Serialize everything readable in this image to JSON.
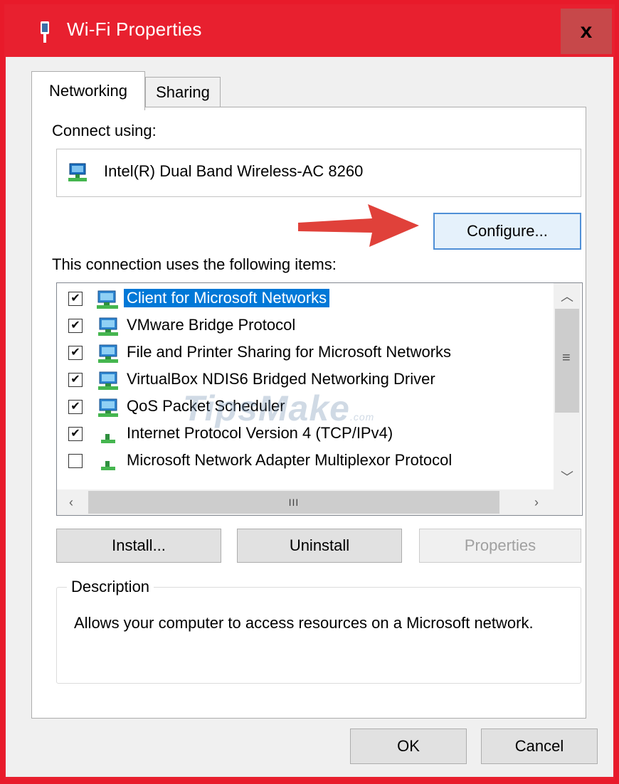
{
  "window": {
    "title": "Wi-Fi Properties",
    "close_glyph": "x",
    "frame_color": "#e81a2a"
  },
  "tabs": [
    {
      "label": "Networking",
      "selected": true
    },
    {
      "label": "Sharing",
      "selected": false
    }
  ],
  "connect_using": {
    "label": "Connect using:",
    "adapter": "Intel(R) Dual Band Wireless-AC 8260",
    "adapter_icon": "network-adapter-icon",
    "configure_label": "Configure..."
  },
  "items_section": {
    "label": "This connection uses the following items:",
    "items": [
      {
        "label": "Client for Microsoft Networks",
        "checked": true,
        "selected": true,
        "icon": "network-client-icon"
      },
      {
        "label": "VMware Bridge Protocol",
        "checked": true,
        "selected": false,
        "icon": "network-service-icon"
      },
      {
        "label": "File and Printer Sharing for Microsoft Networks",
        "checked": true,
        "selected": false,
        "icon": "network-service-icon"
      },
      {
        "label": "VirtualBox NDIS6 Bridged Networking Driver",
        "checked": true,
        "selected": false,
        "icon": "network-service-icon"
      },
      {
        "label": "QoS Packet Scheduler",
        "checked": true,
        "selected": false,
        "icon": "network-service-icon"
      },
      {
        "label": "Internet Protocol Version 4 (TCP/IPv4)",
        "checked": true,
        "selected": false,
        "icon": "network-protocol-icon"
      },
      {
        "label": "Microsoft Network Adapter Multiplexor Protocol",
        "checked": false,
        "selected": false,
        "icon": "network-protocol-icon"
      }
    ]
  },
  "watermark": {
    "text": "TipsMake",
    "suffix": ".com"
  },
  "item_buttons": {
    "install": "Install...",
    "uninstall": "Uninstall",
    "properties": "Properties"
  },
  "description": {
    "title": "Description",
    "text": "Allows your computer to access resources on a Microsoft network."
  },
  "footer": {
    "ok": "OK",
    "cancel": "Cancel"
  },
  "colors": {
    "selection": "#0078d7",
    "arrow": "#e0413a"
  }
}
